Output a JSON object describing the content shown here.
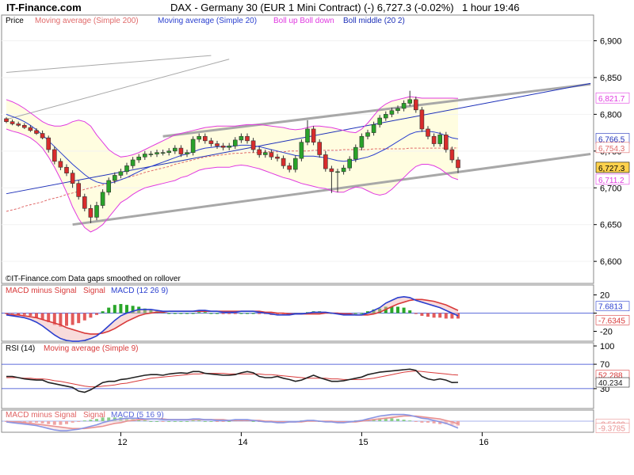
{
  "header": {
    "brand": "IT-Finance.com",
    "title": "DAX - Germany 30 (EUR 1 Mini Contract) (-)     6,727.3 (-0.02%)",
    "timeframe": "1 hour",
    "clock": "19:46"
  },
  "colors": {
    "up": "#29a229",
    "down": "#d82c2c",
    "ma200": "#e06a6a",
    "ma20": "#2a3fcf",
    "boll_band": "#e03ae0",
    "boll_middle": "#1c2fb8",
    "band_fill": "#fffde0",
    "trend": "#a8a8a8",
    "channel_mid": "#1c2fb8",
    "macd_hist": "#2aa62a",
    "macd_hist_neg": "#e35b5b"
  },
  "chart_data": [
    {
      "type": "candlestick",
      "title": "DAX - Germany 30 (EUR 1 Mini Contract) (-)",
      "legend": [
        "Price",
        "Moving average (Simple 200)",
        "Moving average (Simple 20)",
        "Boll up Boll down",
        "Boll middle (20 2)"
      ],
      "ylim": [
        6570,
        6935
      ],
      "yticks": [
        6600,
        6650,
        6700,
        6750,
        6800,
        6850,
        6900
      ],
      "ytick_labels": [
        "6,600",
        "6,650",
        "6,700",
        "6,750",
        "6,800",
        "6,850",
        "6,900"
      ],
      "xticks": [
        {
          "label": "12",
          "bar": 19
        },
        {
          "label": "14",
          "bar": 39
        },
        {
          "label": "15",
          "bar": 59
        },
        {
          "label": "16",
          "bar": 79
        }
      ],
      "bars": 95,
      "last_bar": 75,
      "footnote": "©IT-Finance.com  Data gaps smoothed on rollover",
      "closes": [
        6790,
        6787,
        6785,
        6782,
        6778,
        6774,
        6768,
        6752,
        6736,
        6728,
        6720,
        6706,
        6688,
        6672,
        6660,
        6676,
        6694,
        6710,
        6717,
        6722,
        6730,
        6738,
        6742,
        6746,
        6746,
        6748,
        6748,
        6750,
        6754,
        6746,
        6748,
        6766,
        6770,
        6764,
        6760,
        6757,
        6755,
        6757,
        6765,
        6770,
        6764,
        6752,
        6745,
        6748,
        6742,
        6740,
        6730,
        6725,
        6740,
        6762,
        6780,
        6762,
        6745,
        6726,
        6722,
        6722,
        6727,
        6739,
        6755,
        6770,
        6775,
        6786,
        6795,
        6800,
        6805,
        6808,
        6815,
        6820,
        6806,
        6780,
        6770,
        6760,
        6772,
        6752,
        6738,
        6727.3
      ],
      "opens": [
        6794,
        6790,
        6787,
        6785,
        6782,
        6778,
        6774,
        6768,
        6752,
        6736,
        6728,
        6720,
        6706,
        6688,
        6672,
        6660,
        6676,
        6694,
        6710,
        6717,
        6722,
        6730,
        6738,
        6742,
        6746,
        6746,
        6748,
        6748,
        6750,
        6754,
        6746,
        6748,
        6766,
        6770,
        6764,
        6760,
        6757,
        6755,
        6757,
        6765,
        6770,
        6764,
        6752,
        6745,
        6748,
        6742,
        6740,
        6730,
        6725,
        6740,
        6762,
        6780,
        6762,
        6745,
        6726,
        6722,
        6722,
        6727,
        6739,
        6755,
        6770,
        6775,
        6786,
        6795,
        6800,
        6805,
        6808,
        6815,
        6820,
        6806,
        6780,
        6770,
        6760,
        6772,
        6752,
        6738
      ],
      "highs": [
        6796,
        6793,
        6790,
        6788,
        6785,
        6781,
        6778,
        6771,
        6756,
        6740,
        6732,
        6724,
        6710,
        6692,
        6677,
        6681,
        6698,
        6714,
        6721,
        6726,
        6734,
        6742,
        6746,
        6750,
        6750,
        6752,
        6752,
        6754,
        6758,
        6758,
        6752,
        6770,
        6774,
        6774,
        6768,
        6764,
        6761,
        6761,
        6769,
        6774,
        6774,
        6768,
        6756,
        6752,
        6752,
        6746,
        6744,
        6734,
        6744,
        6766,
        6792,
        6784,
        6766,
        6750,
        6730,
        6726,
        6731,
        6743,
        6759,
        6774,
        6779,
        6790,
        6799,
        6804,
        6809,
        6812,
        6819,
        6832,
        6824,
        6810,
        6784,
        6774,
        6776,
        6776,
        6756,
        6742
      ],
      "lows": [
        6788,
        6785,
        6783,
        6780,
        6776,
        6772,
        6766,
        6748,
        6732,
        6724,
        6716,
        6700,
        6684,
        6668,
        6652,
        6656,
        6672,
        6690,
        6706,
        6713,
        6718,
        6726,
        6734,
        6738,
        6742,
        6742,
        6744,
        6744,
        6746,
        6742,
        6742,
        6744,
        6762,
        6760,
        6756,
        6753,
        6751,
        6751,
        6753,
        6761,
        6760,
        6748,
        6741,
        6741,
        6738,
        6736,
        6726,
        6721,
        6721,
        6736,
        6758,
        6758,
        6741,
        6722,
        6693,
        6694,
        6718,
        6723,
        6735,
        6751,
        6766,
        6771,
        6782,
        6791,
        6796,
        6801,
        6804,
        6811,
        6802,
        6776,
        6766,
        6756,
        6756,
        6748,
        6734,
        6720
      ],
      "ma20": [
        6800,
        6797,
        6794,
        6790,
        6785,
        6779,
        6772,
        6764,
        6756,
        6748,
        6740,
        6732,
        6725,
        6718,
        6712,
        6708,
        6706,
        6706,
        6708,
        6711,
        6714,
        6718,
        6722,
        6726,
        6729,
        6732,
        6735,
        6738,
        6741,
        6744,
        6746,
        6749,
        6752,
        6754,
        6755,
        6756,
        6756,
        6756,
        6757,
        6758,
        6758,
        6757,
        6756,
        6754,
        6752,
        6750,
        6748,
        6746,
        6744,
        6743,
        6743,
        6743,
        6742,
        6741,
        6739,
        6737,
        6736,
        6737,
        6738,
        6740,
        6742,
        6745,
        6749,
        6753,
        6758,
        6763,
        6768,
        6773,
        6776,
        6777,
        6777,
        6776,
        6774,
        6771,
        6768,
        6766.5
      ],
      "boll_up": [
        6820,
        6817,
        6813,
        6808,
        6802,
        6796,
        6790,
        6786,
        6784,
        6784,
        6786,
        6790,
        6792,
        6790,
        6784,
        6772,
        6762,
        6752,
        6746,
        6742,
        6743,
        6745,
        6748,
        6752,
        6756,
        6760,
        6764,
        6768,
        6772,
        6774,
        6776,
        6778,
        6780,
        6782,
        6783,
        6784,
        6784,
        6784,
        6784,
        6785,
        6786,
        6786,
        6786,
        6785,
        6784,
        6783,
        6782,
        6780,
        6779,
        6780,
        6782,
        6784,
        6784,
        6783,
        6782,
        6780,
        6778,
        6776,
        6775,
        6780,
        6788,
        6798,
        6808,
        6814,
        6818,
        6820,
        6822,
        6824,
        6823,
        6822,
        6822,
        6822,
        6822,
        6822,
        6822,
        6821.7
      ],
      "boll_down": [
        6780,
        6777,
        6775,
        6772,
        6768,
        6762,
        6754,
        6742,
        6728,
        6712,
        6694,
        6674,
        6658,
        6646,
        6640,
        6644,
        6650,
        6660,
        6670,
        6680,
        6685,
        6691,
        6696,
        6700,
        6702,
        6704,
        6706,
        6708,
        6710,
        6714,
        6716,
        6720,
        6724,
        6726,
        6727,
        6728,
        6728,
        6728,
        6730,
        6731,
        6730,
        6728,
        6726,
        6723,
        6720,
        6717,
        6714,
        6712,
        6709,
        6706,
        6704,
        6702,
        6700,
        6699,
        6696,
        6694,
        6694,
        6698,
        6701,
        6700,
        6696,
        6692,
        6690,
        6692,
        6698,
        6706,
        6714,
        6722,
        6729,
        6732,
        6732,
        6730,
        6726,
        6720,
        6714,
        6711.2
      ],
      "ma200": [
        6668,
        6670,
        6672,
        6675,
        6677,
        6679,
        6681,
        6684,
        6686,
        6688,
        6691,
        6693,
        6695,
        6698,
        6700,
        6702,
        6704,
        6707,
        6709,
        6711,
        6714,
        6716,
        6718,
        6721,
        6723,
        6725,
        6727,
        6729,
        6732,
        6734,
        6736,
        6738,
        6740,
        6742,
        6743,
        6744,
        6745,
        6746,
        6747,
        6747,
        6748,
        6748,
        6748,
        6749,
        6749,
        6749,
        6749,
        6750,
        6750,
        6750,
        6750,
        6751,
        6751,
        6751,
        6751,
        6751,
        6752,
        6752,
        6752,
        6752,
        6752,
        6753,
        6753,
        6753,
        6753,
        6753,
        6753,
        6754,
        6754,
        6754,
        6754,
        6754,
        6754,
        6754,
        6754,
        6754.3
      ],
      "trendlines": [
        {
          "name": "upper channel",
          "from": {
            "bar": 26,
            "y": 6770
          },
          "to": {
            "bar": 97,
            "y": 6841
          },
          "color": "#a8a8a8"
        },
        {
          "name": "lower channel",
          "from": {
            "bar": 11,
            "y": 6650
          },
          "to": {
            "bar": 97,
            "y": 6746
          },
          "color": "#a8a8a8"
        },
        {
          "name": "middle line",
          "from": {
            "bar": 0,
            "y": 6692
          },
          "to": {
            "bar": 97,
            "y": 6842
          },
          "color": "#1c2fb8"
        },
        {
          "name": "thin upper",
          "from": {
            "bar": 0,
            "y": 6857
          },
          "to": {
            "bar": 34,
            "y": 6880
          },
          "color": "#a8a8a8"
        },
        {
          "name": "thin upper 2",
          "from": {
            "bar": 0,
            "y": 6793
          },
          "to": {
            "bar": 37,
            "y": 6875
          },
          "color": "#a8a8a8"
        }
      ],
      "last_values": [
        {
          "label": "6,821.7",
          "color": "#e03ae0",
          "fill": "#ffffff",
          "y": 6821.7
        },
        {
          "label": "6,766.5",
          "color": "#1c2fb8",
          "fill": "#ffffff",
          "y": 6766.5
        },
        {
          "label": "6,754.3",
          "color": "#e06a6a",
          "fill": "#ffffff",
          "y": 6754.3
        },
        {
          "label": "6,727.3",
          "color": "#000000",
          "fill": "#ffd24d",
          "y": 6727.3
        },
        {
          "label": "6,711.2",
          "color": "#e03ae0",
          "fill": "#ffffff",
          "y": 6711.2
        }
      ]
    },
    {
      "type": "macd",
      "legend": [
        "MACD minus Signal",
        "Signal",
        "MACD (12 26 9)"
      ],
      "ylim": [
        -30,
        30
      ],
      "yticks": [
        20,
        0,
        -20
      ],
      "ytick_labels": [
        "20",
        "",
        "-20"
      ],
      "last_values": [
        {
          "label": "7.6813",
          "color": "#2a3fcf",
          "y": 7.6813
        },
        {
          "label": "-7.6345",
          "color": "#d83a3a",
          "y": -7.6345
        }
      ],
      "macd": [
        -2,
        -3,
        -4,
        -5,
        -7,
        -10,
        -14,
        -19,
        -24,
        -28,
        -30,
        -31,
        -31,
        -30,
        -28,
        -25,
        -20,
        -14,
        -8,
        -3,
        0,
        2,
        4,
        4,
        4,
        3,
        2,
        2,
        2,
        2,
        2,
        2,
        3,
        3,
        2,
        2,
        1,
        1,
        1,
        2,
        2,
        2,
        1,
        0,
        -1,
        -2,
        -2,
        -2,
        -1,
        -1,
        0,
        1,
        1,
        1,
        0,
        -1,
        -2,
        -2,
        -2,
        -2,
        0,
        3,
        6,
        11,
        14,
        17,
        18,
        17,
        14,
        12,
        10,
        8,
        6,
        3,
        0,
        -3
      ],
      "signal": [
        -1,
        -2,
        -2,
        -3,
        -4,
        -5,
        -7,
        -9,
        -11,
        -13,
        -16,
        -18,
        -20,
        -22,
        -23,
        -23,
        -22,
        -20,
        -17,
        -13,
        -9,
        -6,
        -3,
        -1,
        0,
        1,
        1,
        2,
        2,
        2,
        2,
        2,
        2,
        2,
        2,
        2,
        2,
        2,
        2,
        2,
        2,
        2,
        2,
        1,
        1,
        0,
        0,
        -1,
        -1,
        -1,
        -1,
        -1,
        -1,
        0,
        0,
        0,
        -1,
        -1,
        -2,
        -2,
        -2,
        -1,
        1,
        4,
        7,
        10,
        12,
        14,
        15,
        15,
        14,
        13,
        11,
        9,
        6,
        3
      ]
    },
    {
      "type": "line",
      "legend": [
        "RSI (14)",
        "Moving average (Simple 9)"
      ],
      "ylim": [
        0,
        100
      ],
      "yticks": [
        100,
        70,
        30
      ],
      "ytick_labels": [
        "100",
        "70",
        "30"
      ],
      "last_values": [
        {
          "label": "52.288",
          "color": "#d83a3a",
          "y": 52.288
        },
        {
          "label": "40.234",
          "color": "#222222",
          "y": 40.234
        }
      ],
      "rsi": [
        50,
        50,
        48,
        46,
        45,
        44,
        44,
        40,
        38,
        36,
        34,
        32,
        26,
        24,
        28,
        34,
        40,
        42,
        42,
        45,
        46,
        48,
        50,
        52,
        53,
        53,
        52,
        54,
        55,
        56,
        55,
        58,
        58,
        55,
        54,
        53,
        52,
        52,
        53,
        56,
        58,
        56,
        50,
        48,
        48,
        50,
        47,
        45,
        42,
        44,
        48,
        52,
        48,
        45,
        42,
        42,
        43,
        45,
        47,
        49,
        53,
        55,
        57,
        58,
        59,
        60,
        61,
        62,
        60,
        50,
        46,
        44,
        46,
        44,
        40,
        40.234
      ],
      "rsi_ma": [
        48,
        48,
        48,
        47,
        47,
        46,
        46,
        45,
        43,
        42,
        40,
        38,
        36,
        34,
        33,
        33,
        34,
        35,
        36,
        38,
        39,
        41,
        43,
        45,
        47,
        48,
        49,
        50,
        51,
        52,
        53,
        54,
        54,
        55,
        55,
        55,
        55,
        54,
        54,
        54,
        54,
        54,
        54,
        53,
        53,
        52,
        51,
        50,
        49,
        48,
        47,
        47,
        47,
        47,
        46,
        46,
        45,
        45,
        45,
        45,
        46,
        47,
        49,
        51,
        53,
        55,
        57,
        58,
        59,
        58,
        57,
        56,
        55,
        54,
        53,
        52.288
      ]
    },
    {
      "type": "macd",
      "legend": [
        "MACD minus Signal",
        "Signal",
        "MACD (5 16 9)"
      ],
      "ylim": [
        -14,
        14
      ],
      "yticks": [],
      "ytick_labels": [],
      "last_values": [
        {
          "label": "-3.5129",
          "color": "#d83a3a",
          "y": -3.5129
        },
        {
          "label": "-9.3785",
          "color": "#d83a3a",
          "y": -9.3785
        }
      ],
      "macd": [
        -1,
        -2,
        -3,
        -4,
        -5,
        -6,
        -8,
        -10,
        -12,
        -13,
        -13,
        -12,
        -11,
        -9,
        -7,
        -5,
        -2,
        0,
        2,
        3,
        4,
        4,
        4,
        3,
        3,
        3,
        2,
        2,
        2,
        2,
        2,
        3,
        3,
        2,
        2,
        1,
        1,
        1,
        2,
        2,
        2,
        1,
        0,
        -1,
        -1,
        -2,
        -2,
        -1,
        -1,
        0,
        1,
        1,
        0,
        -1,
        -1,
        -2,
        -2,
        -1,
        0,
        1,
        3,
        5,
        7,
        8,
        9,
        9,
        9,
        8,
        6,
        4,
        3,
        1,
        -1,
        -3,
        -6,
        -9.3785
      ],
      "signal": [
        0,
        -1,
        -1,
        -2,
        -3,
        -4,
        -5,
        -6,
        -7,
        -8,
        -9,
        -10,
        -10,
        -10,
        -9,
        -8,
        -7,
        -5,
        -3,
        -2,
        0,
        1,
        2,
        2,
        3,
        3,
        3,
        2,
        2,
        2,
        2,
        2,
        2,
        2,
        2,
        2,
        2,
        1,
        1,
        1,
        1,
        1,
        1,
        0,
        0,
        -1,
        -1,
        -1,
        -1,
        -1,
        0,
        0,
        0,
        0,
        0,
        -1,
        -1,
        -1,
        -1,
        0,
        1,
        2,
        3,
        4,
        5,
        6,
        7,
        7,
        7,
        6,
        5,
        4,
        3,
        1,
        -1,
        -3.5129
      ]
    }
  ]
}
